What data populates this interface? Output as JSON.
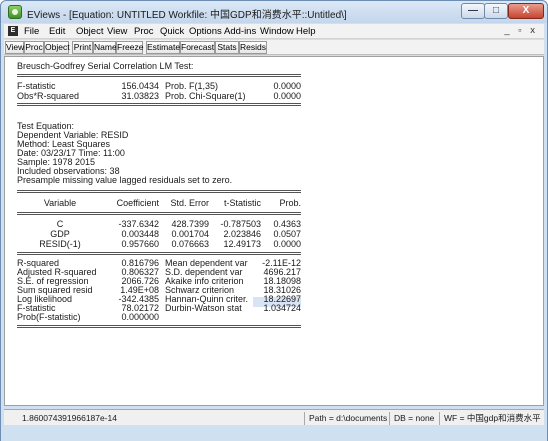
{
  "window": {
    "title": "EViews - [Equation: UNTITLED   Workfile: 中国GDP和消费水平::Untitled\\]",
    "minimize_glyph": "—",
    "maximize_glyph": "□",
    "close_glyph": "X",
    "app_icon": "eviews-icon"
  },
  "menubar": {
    "doc_icon_letter": "E",
    "items": [
      "File",
      "Edit",
      "Object",
      "View",
      "Proc",
      "Quick",
      "Options",
      "Add-ins",
      "Window",
      "Help"
    ],
    "right_controls": "_ ▫ x"
  },
  "toolbar": {
    "buttons": [
      "View",
      "Proc",
      "Object",
      "Print",
      "Name",
      "Freeze",
      "Estimate",
      "Forecast",
      "Stats",
      "Resids"
    ]
  },
  "output": {
    "test_title": "Breusch-Godfrey Serial Correlation LM Test:",
    "test_stats": [
      {
        "label": "F-statistic",
        "value": "156.0434",
        "prob_label": "Prob. F(1,35)",
        "prob": "0.0000"
      },
      {
        "label": "Obs*R-squared",
        "value": "31.03823",
        "prob_label": "Prob. Chi-Square(1)",
        "prob": "0.0000"
      }
    ],
    "info_lines": [
      "Test Equation:",
      "Dependent Variable: RESID",
      "Method: Least Squares",
      "Date: 03/23/17   Time: 11:00",
      "Sample: 1978 2015",
      "Included observations: 38",
      "Presample missing value lagged residuals set to zero."
    ],
    "coef_headers": [
      "Variable",
      "Coefficient",
      "Std. Error",
      "t-Statistic",
      "Prob."
    ],
    "coef_rows": [
      [
        "C",
        "-337.6342",
        "428.7399",
        "-0.787503",
        "0.4363"
      ],
      [
        "GDP",
        "0.003448",
        "0.001704",
        "2.023846",
        "0.0507"
      ],
      [
        "RESID(-1)",
        "0.957660",
        "0.076663",
        "12.49173",
        "0.0000"
      ]
    ],
    "summary_left": [
      [
        "R-squared",
        "0.816796"
      ],
      [
        "Adjusted R-squared",
        "0.806327"
      ],
      [
        "S.E. of regression",
        "2066.726"
      ],
      [
        "Sum squared resid",
        "1.49E+08"
      ],
      [
        "Log likelihood",
        "-342.4385"
      ],
      [
        "F-statistic",
        "78.02172"
      ],
      [
        "Prob(F-statistic)",
        "0.000000"
      ]
    ],
    "summary_right": [
      [
        "Mean dependent var",
        "-2.11E-12"
      ],
      [
        "S.D. dependent var",
        "4696.217"
      ],
      [
        "Akaike info criterion",
        "18.18098"
      ],
      [
        "Schwarz criterion",
        "18.31026"
      ],
      [
        "Hannan-Quinn criter.",
        "18.22697"
      ],
      [
        "Durbin-Watson stat",
        "1.034724"
      ]
    ]
  },
  "statusbar": {
    "message": "1.860074391966187e-14",
    "path": "Path = d:\\documents",
    "db": "DB = none",
    "wf": "WF = 中国gdp和消费水平"
  }
}
